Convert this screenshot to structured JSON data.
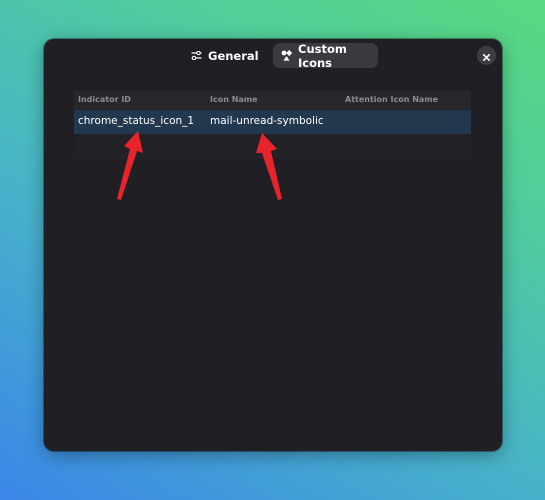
{
  "tabs": [
    {
      "label": "General",
      "icon": "settings-sliders-icon",
      "active": false
    },
    {
      "label": "Custom Icons",
      "icon": "shapes-icon",
      "active": true
    }
  ],
  "close_icon": "close-icon",
  "table": {
    "headers": [
      "Indicator ID",
      "Icon Name",
      "Attention Icon Name"
    ],
    "rows": [
      [
        "chrome_status_icon_1",
        "mail-unread-symbolic",
        ""
      ]
    ]
  },
  "annotations": {
    "arrow_color": "#e8232b"
  },
  "colors": {
    "window_bg": "#202024",
    "selected_row": "#22384f",
    "active_tab": "#3a3a3f"
  }
}
